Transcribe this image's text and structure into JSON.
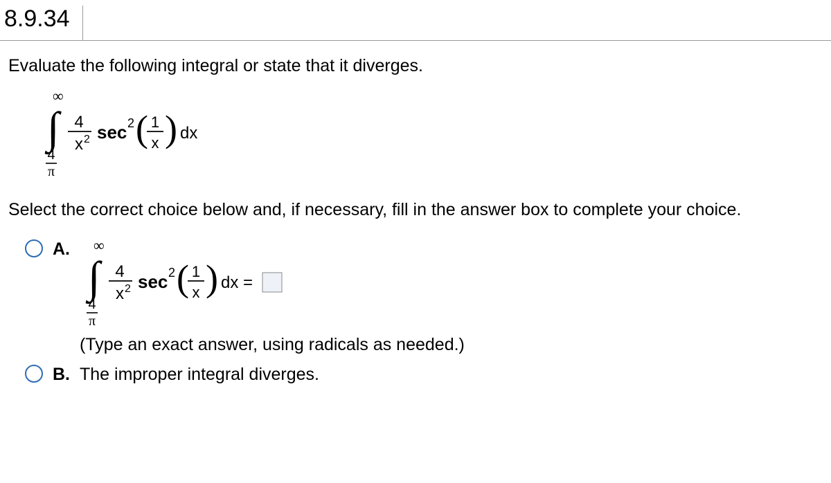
{
  "header": {
    "question_number": "8.9.34"
  },
  "prompt": "Evaluate the following integral or state that it diverges.",
  "integral": {
    "upper": "∞",
    "lower_num": "4",
    "lower_den": "π",
    "coeff_num": "4",
    "coeff_den_base": "x",
    "coeff_den_exp": "2",
    "func": "sec",
    "func_exp": "2",
    "arg_num": "1",
    "arg_den": "x",
    "diff": "dx"
  },
  "instruction": "Select the correct choice below and, if necessary, fill in the answer box to complete your choice.",
  "choices": {
    "a": {
      "label": "A.",
      "equals": "dx =",
      "hint": "(Type an exact answer, using radicals as needed.)"
    },
    "b": {
      "label": "B.",
      "text": "The improper integral diverges."
    }
  }
}
